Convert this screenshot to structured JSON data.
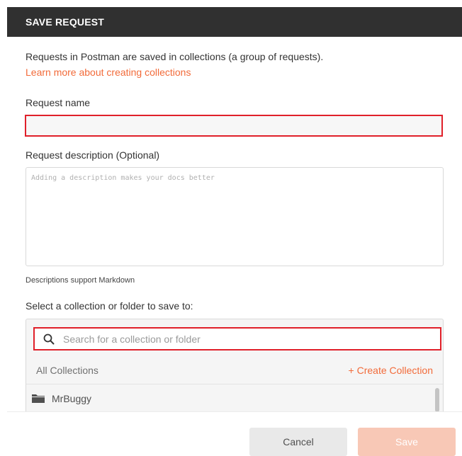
{
  "dialog": {
    "title": "SAVE REQUEST",
    "intro_text": "Requests in Postman are saved in collections (a group of requests).",
    "learn_more_link": "Learn more about creating collections"
  },
  "request_name": {
    "label": "Request name",
    "value": "",
    "placeholder": ""
  },
  "request_description": {
    "label": "Request description (Optional)",
    "value": "",
    "placeholder": "Adding a description makes your docs better",
    "markdown_note": "Descriptions support Markdown"
  },
  "collection_picker": {
    "label": "Select a collection or folder to save to:",
    "search_placeholder": "Search for a collection or folder",
    "search_value": "",
    "breadcrumb": "All Collections",
    "create_collection_label": "+ Create Collection",
    "items": [
      {
        "name": "MrBuggy",
        "icon": "folder-icon"
      }
    ]
  },
  "footer": {
    "cancel_label": "Cancel",
    "save_label": "Save"
  },
  "colors": {
    "header_bg": "#303030",
    "accent": "#f26b3a",
    "highlight_border": "#e0202a",
    "save_disabled_bg": "#f8c8b6",
    "cancel_bg": "#e9e9e9"
  }
}
